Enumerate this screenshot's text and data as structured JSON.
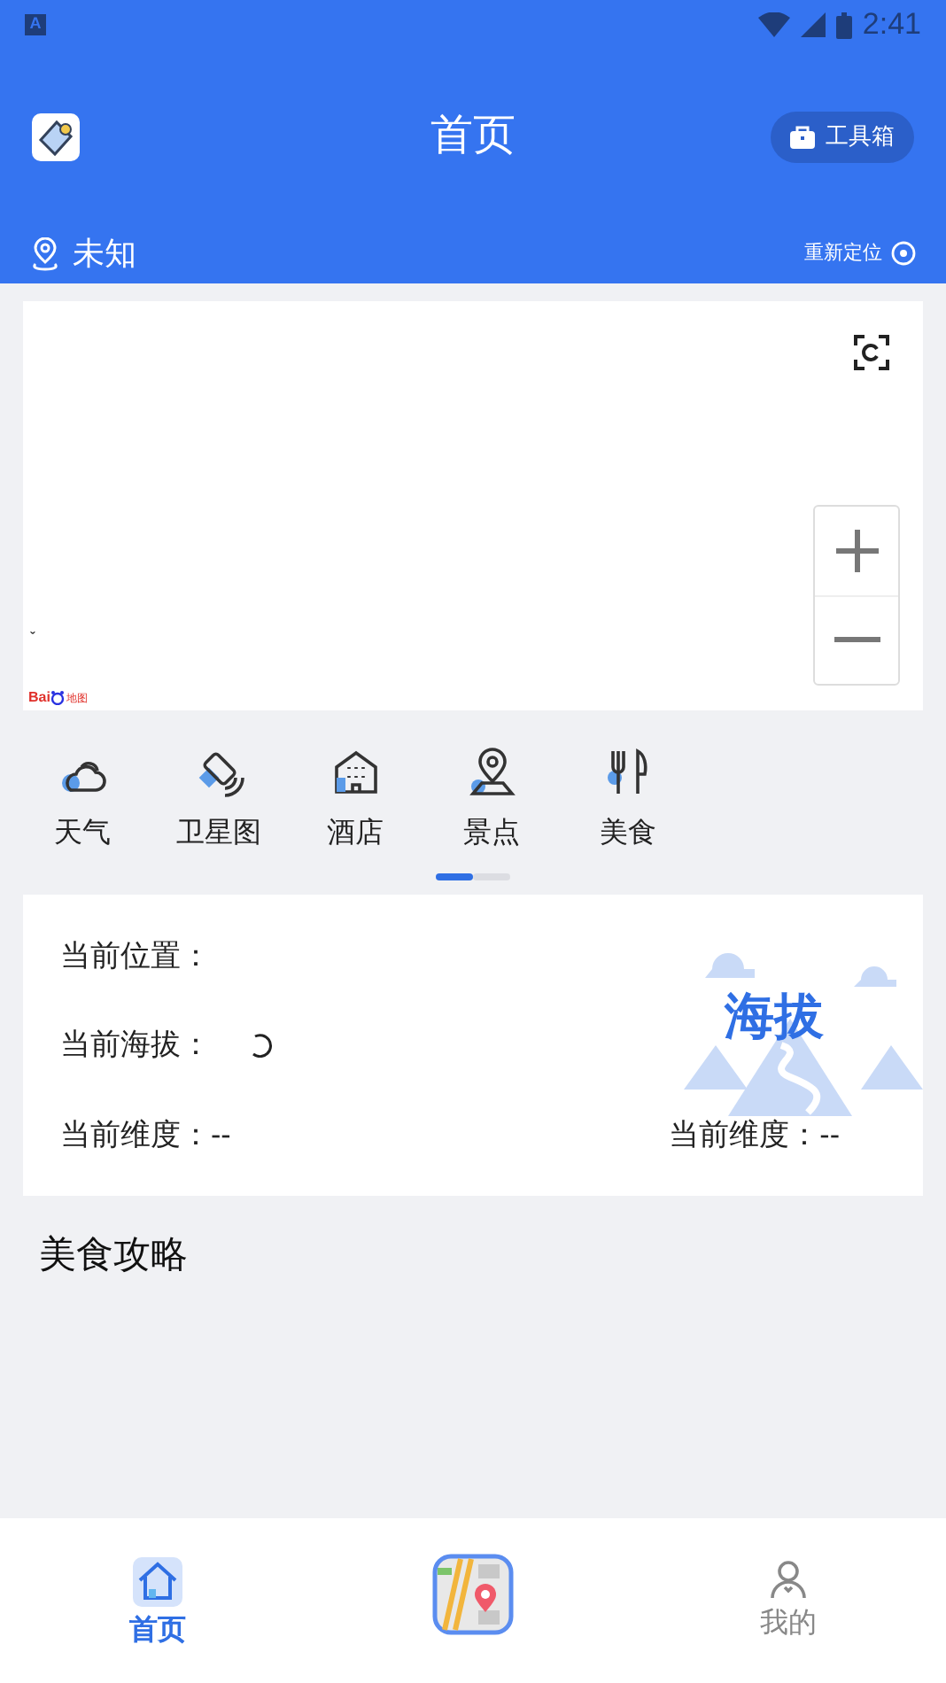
{
  "status_bar": {
    "time": "2:41",
    "notification_icon": "A"
  },
  "header": {
    "title": "首页",
    "toolbox_button": "工具箱"
  },
  "location_bar": {
    "city": "未知",
    "relocate": "重新定位"
  },
  "map": {
    "logo_text_1": "Bai",
    "logo_text_2": "地图",
    "corner_mark": "ˇ"
  },
  "categories": [
    {
      "label": "天气",
      "kind": "weather"
    },
    {
      "label": "卫星图",
      "kind": "satellite"
    },
    {
      "label": "酒店",
      "kind": "hotel"
    },
    {
      "label": "景点",
      "kind": "scenic"
    },
    {
      "label": "美食",
      "kind": "food"
    }
  ],
  "pager": [
    {
      "selected": true
    },
    {
      "selected": false
    }
  ],
  "info_card": {
    "position_label": "当前位置：",
    "altitude_label": "当前海拔：",
    "altitude_loading": true,
    "latitude_label": "当前维度：",
    "latitude_value": "--",
    "longitude_label": "当前维度：",
    "longitude_value": "--",
    "illustration_text": "海拔"
  },
  "section_title": "美食攻略",
  "bottom_nav": [
    {
      "label": "首页",
      "kind": "home",
      "selected": true
    },
    {
      "kind": "map",
      "selected": false
    },
    {
      "label": "我的",
      "kind": "profile",
      "selected": false
    }
  ]
}
